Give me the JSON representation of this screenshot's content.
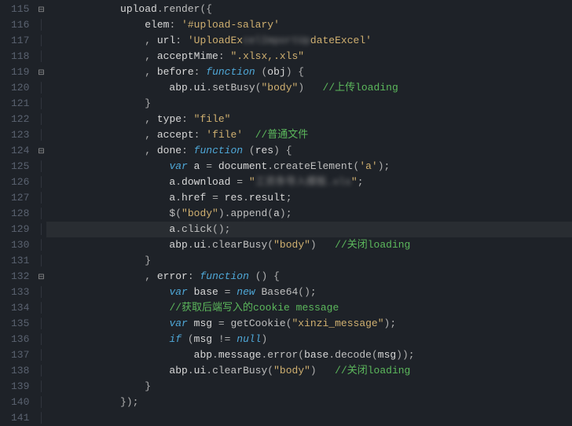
{
  "lineStart": 115,
  "lineEnd": 141,
  "highlightLine": 129,
  "foldMarkers": {
    "115": "minus",
    "119": "minus",
    "124": "minus",
    "132": "minus"
  },
  "bracketDepth": 3,
  "code": {
    "115": [
      [
        "def",
        "            upload"
      ],
      [
        "punct",
        "."
      ],
      [
        "method",
        "render"
      ],
      [
        "punct",
        "({"
      ]
    ],
    "116": [
      [
        "def",
        "                elem"
      ],
      [
        "punct",
        ": "
      ],
      [
        "string",
        "'#upload-salary'"
      ]
    ],
    "117": [
      [
        "punct",
        "                , "
      ],
      [
        "def",
        "url"
      ],
      [
        "punct",
        ": "
      ],
      [
        "string",
        "'UploadEx"
      ],
      [
        "blur",
        "celImportUp"
      ],
      [
        "string",
        "dateExcel'"
      ]
    ],
    "118": [
      [
        "punct",
        "                , "
      ],
      [
        "def",
        "acceptMime"
      ],
      [
        "punct",
        ": "
      ],
      [
        "string",
        "\".xlsx,.xls\""
      ]
    ],
    "119": [
      [
        "punct",
        "                , "
      ],
      [
        "def",
        "before"
      ],
      [
        "punct",
        ": "
      ],
      [
        "keyword",
        "function"
      ],
      [
        "punct",
        " ("
      ],
      [
        "def",
        "obj"
      ],
      [
        "punct",
        ") {"
      ]
    ],
    "120": [
      [
        "def",
        "                    abp"
      ],
      [
        "punct",
        "."
      ],
      [
        "def",
        "ui"
      ],
      [
        "punct",
        "."
      ],
      [
        "method",
        "setBusy"
      ],
      [
        "punct",
        "("
      ],
      [
        "string",
        "\"body\""
      ],
      [
        "punct",
        ")   "
      ],
      [
        "comment",
        "//上传loading"
      ]
    ],
    "121": [
      [
        "punct",
        "                }"
      ]
    ],
    "122": [
      [
        "punct",
        "                , "
      ],
      [
        "def",
        "type"
      ],
      [
        "punct",
        ": "
      ],
      [
        "string",
        "\"file\""
      ]
    ],
    "123": [
      [
        "punct",
        "                , "
      ],
      [
        "def",
        "accept"
      ],
      [
        "punct",
        ": "
      ],
      [
        "string",
        "'file'"
      ],
      [
        "punct",
        "  "
      ],
      [
        "comment",
        "//普通文件"
      ]
    ],
    "124": [
      [
        "punct",
        "                , "
      ],
      [
        "def",
        "done"
      ],
      [
        "punct",
        ": "
      ],
      [
        "keyword",
        "function"
      ],
      [
        "punct",
        " ("
      ],
      [
        "def",
        "res"
      ],
      [
        "punct",
        ") {"
      ]
    ],
    "125": [
      [
        "punct",
        "                    "
      ],
      [
        "keyword",
        "var"
      ],
      [
        "def",
        " a "
      ],
      [
        "punct",
        "= "
      ],
      [
        "def",
        "document"
      ],
      [
        "punct",
        "."
      ],
      [
        "method",
        "createElement"
      ],
      [
        "punct",
        "("
      ],
      [
        "string",
        "'a'"
      ],
      [
        "punct",
        ");"
      ]
    ],
    "126": [
      [
        "def",
        "                    a"
      ],
      [
        "punct",
        "."
      ],
      [
        "def",
        "download "
      ],
      [
        "punct",
        "= "
      ],
      [
        "string",
        "\""
      ],
      [
        "blur",
        "工资条导入模板.xls"
      ],
      [
        "string",
        "\""
      ],
      [
        "punct",
        ";"
      ]
    ],
    "127": [
      [
        "def",
        "                    a"
      ],
      [
        "punct",
        "."
      ],
      [
        "def",
        "href "
      ],
      [
        "punct",
        "= "
      ],
      [
        "def",
        "res"
      ],
      [
        "punct",
        "."
      ],
      [
        "def",
        "result"
      ],
      [
        "punct",
        ";"
      ]
    ],
    "128": [
      [
        "method",
        "                    $"
      ],
      [
        "punct",
        "("
      ],
      [
        "string",
        "\"body\""
      ],
      [
        "punct",
        ")."
      ],
      [
        "method",
        "append"
      ],
      [
        "punct",
        "("
      ],
      [
        "def",
        "a"
      ],
      [
        "punct",
        ");"
      ]
    ],
    "129": [
      [
        "def",
        "                    a"
      ],
      [
        "punct",
        "."
      ],
      [
        "method",
        "click"
      ],
      [
        "punct",
        "();"
      ]
    ],
    "130": [
      [
        "def",
        "                    abp"
      ],
      [
        "punct",
        "."
      ],
      [
        "def",
        "ui"
      ],
      [
        "punct",
        "."
      ],
      [
        "method",
        "clearBusy"
      ],
      [
        "punct",
        "("
      ],
      [
        "string",
        "\"body\""
      ],
      [
        "punct",
        ")   "
      ],
      [
        "comment",
        "//关闭loading"
      ]
    ],
    "131": [
      [
        "punct",
        "                }"
      ]
    ],
    "132": [
      [
        "punct",
        "                , "
      ],
      [
        "def",
        "error"
      ],
      [
        "punct",
        ": "
      ],
      [
        "keyword",
        "function"
      ],
      [
        "punct",
        " () {"
      ]
    ],
    "133": [
      [
        "punct",
        "                    "
      ],
      [
        "keyword",
        "var"
      ],
      [
        "def",
        " base "
      ],
      [
        "punct",
        "= "
      ],
      [
        "new",
        "new"
      ],
      [
        "def",
        " "
      ],
      [
        "method",
        "Base64"
      ],
      [
        "punct",
        "();"
      ]
    ],
    "134": [
      [
        "punct",
        "                    "
      ],
      [
        "comment",
        "//获取后端写入的cookie message"
      ]
    ],
    "135": [
      [
        "punct",
        "                    "
      ],
      [
        "keyword",
        "var"
      ],
      [
        "def",
        " msg "
      ],
      [
        "punct",
        "= "
      ],
      [
        "method",
        "getCookie"
      ],
      [
        "punct",
        "("
      ],
      [
        "string",
        "\"xinzi_message\""
      ],
      [
        "punct",
        ");"
      ]
    ],
    "136": [
      [
        "punct",
        "                    "
      ],
      [
        "keyword",
        "if"
      ],
      [
        "punct",
        " ("
      ],
      [
        "def",
        "msg "
      ],
      [
        "punct",
        "!= "
      ],
      [
        "keyword",
        "null"
      ],
      [
        "punct",
        ")"
      ]
    ],
    "137": [
      [
        "def",
        "                        abp"
      ],
      [
        "punct",
        "."
      ],
      [
        "def",
        "message"
      ],
      [
        "punct",
        "."
      ],
      [
        "method",
        "error"
      ],
      [
        "punct",
        "("
      ],
      [
        "def",
        "base"
      ],
      [
        "punct",
        "."
      ],
      [
        "method",
        "decode"
      ],
      [
        "punct",
        "("
      ],
      [
        "def",
        "msg"
      ],
      [
        "punct",
        "));"
      ]
    ],
    "138": [
      [
        "def",
        "                    abp"
      ],
      [
        "punct",
        "."
      ],
      [
        "def",
        "ui"
      ],
      [
        "punct",
        "."
      ],
      [
        "method",
        "clearBusy"
      ],
      [
        "punct",
        "("
      ],
      [
        "string",
        "\"body\""
      ],
      [
        "punct",
        ")   "
      ],
      [
        "comment",
        "//关闭loading"
      ]
    ],
    "139": [
      [
        "punct",
        "                }"
      ]
    ],
    "140": [
      [
        "punct",
        "            });"
      ]
    ],
    "141": [
      [
        "punct",
        ""
      ]
    ]
  }
}
